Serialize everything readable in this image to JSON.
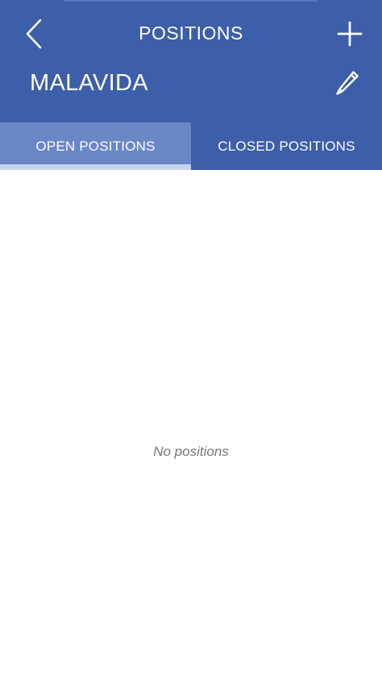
{
  "header": {
    "title": "POSITIONS",
    "portfolio_name": "MALAVIDA"
  },
  "tabs": [
    {
      "label": "OPEN POSITIONS",
      "active": true
    },
    {
      "label": "CLOSED POSITIONS",
      "active": false
    }
  ],
  "empty_state": {
    "message": "No positions"
  },
  "icons": {
    "back": "chevron-left-icon",
    "add": "plus-icon",
    "edit": "pencil-icon"
  },
  "colors": {
    "header_bg": "#3d5ea8",
    "active_tab_bg": "#6a87c6",
    "tab_indicator": "#c7d3ee",
    "empty_text": "#777777"
  }
}
